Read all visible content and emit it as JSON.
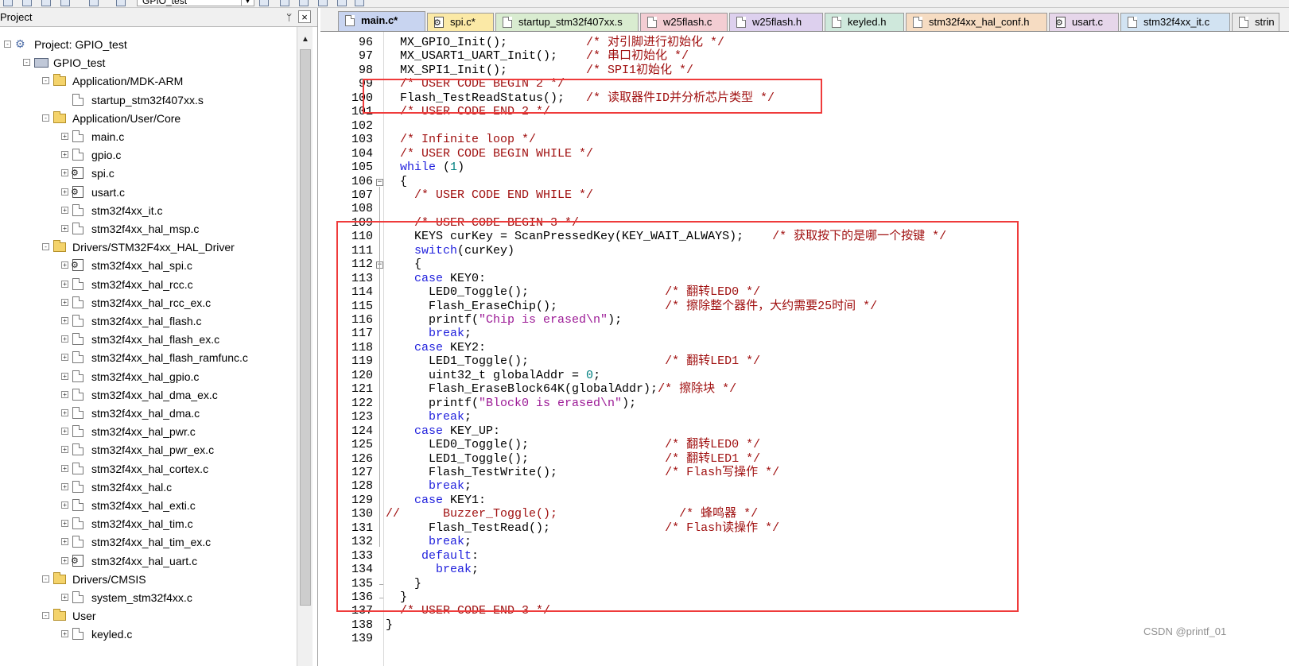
{
  "toolbar": {
    "target_name": "GPIO_test"
  },
  "project_panel": {
    "title": "Project",
    "pin_glyph": "ᛘ",
    "close_glyph": "×",
    "tree": [
      {
        "label": "Project: GPIO_test",
        "depth": 0,
        "kind": "project",
        "expander": "-"
      },
      {
        "label": "GPIO_test",
        "depth": 1,
        "kind": "target",
        "expander": "-"
      },
      {
        "label": "Application/MDK-ARM",
        "depth": 2,
        "kind": "folder",
        "expander": "-"
      },
      {
        "label": "startup_stm32f407xx.s",
        "depth": 3,
        "kind": "file",
        "expander": ""
      },
      {
        "label": "Application/User/Core",
        "depth": 2,
        "kind": "folder",
        "expander": "-"
      },
      {
        "label": "main.c",
        "depth": 3,
        "kind": "file",
        "expander": "+"
      },
      {
        "label": "gpio.c",
        "depth": 3,
        "kind": "file",
        "expander": "+"
      },
      {
        "label": "spi.c",
        "depth": 3,
        "kind": "gearfile",
        "expander": "+"
      },
      {
        "label": "usart.c",
        "depth": 3,
        "kind": "gearfile",
        "expander": "+"
      },
      {
        "label": "stm32f4xx_it.c",
        "depth": 3,
        "kind": "file",
        "expander": "+"
      },
      {
        "label": "stm32f4xx_hal_msp.c",
        "depth": 3,
        "kind": "file",
        "expander": "+"
      },
      {
        "label": "Drivers/STM32F4xx_HAL_Driver",
        "depth": 2,
        "kind": "folder",
        "expander": "-"
      },
      {
        "label": "stm32f4xx_hal_spi.c",
        "depth": 3,
        "kind": "gearfile",
        "expander": "+"
      },
      {
        "label": "stm32f4xx_hal_rcc.c",
        "depth": 3,
        "kind": "file",
        "expander": "+"
      },
      {
        "label": "stm32f4xx_hal_rcc_ex.c",
        "depth": 3,
        "kind": "file",
        "expander": "+"
      },
      {
        "label": "stm32f4xx_hal_flash.c",
        "depth": 3,
        "kind": "file",
        "expander": "+"
      },
      {
        "label": "stm32f4xx_hal_flash_ex.c",
        "depth": 3,
        "kind": "file",
        "expander": "+"
      },
      {
        "label": "stm32f4xx_hal_flash_ramfunc.c",
        "depth": 3,
        "kind": "file",
        "expander": "+"
      },
      {
        "label": "stm32f4xx_hal_gpio.c",
        "depth": 3,
        "kind": "file",
        "expander": "+"
      },
      {
        "label": "stm32f4xx_hal_dma_ex.c",
        "depth": 3,
        "kind": "file",
        "expander": "+"
      },
      {
        "label": "stm32f4xx_hal_dma.c",
        "depth": 3,
        "kind": "file",
        "expander": "+"
      },
      {
        "label": "stm32f4xx_hal_pwr.c",
        "depth": 3,
        "kind": "file",
        "expander": "+"
      },
      {
        "label": "stm32f4xx_hal_pwr_ex.c",
        "depth": 3,
        "kind": "file",
        "expander": "+"
      },
      {
        "label": "stm32f4xx_hal_cortex.c",
        "depth": 3,
        "kind": "file",
        "expander": "+"
      },
      {
        "label": "stm32f4xx_hal.c",
        "depth": 3,
        "kind": "file",
        "expander": "+"
      },
      {
        "label": "stm32f4xx_hal_exti.c",
        "depth": 3,
        "kind": "file",
        "expander": "+"
      },
      {
        "label": "stm32f4xx_hal_tim.c",
        "depth": 3,
        "kind": "file",
        "expander": "+"
      },
      {
        "label": "stm32f4xx_hal_tim_ex.c",
        "depth": 3,
        "kind": "file",
        "expander": "+"
      },
      {
        "label": "stm32f4xx_hal_uart.c",
        "depth": 3,
        "kind": "gearfile",
        "expander": "+"
      },
      {
        "label": "Drivers/CMSIS",
        "depth": 2,
        "kind": "folder",
        "expander": "-"
      },
      {
        "label": "system_stm32f4xx.c",
        "depth": 3,
        "kind": "file",
        "expander": "+"
      },
      {
        "label": "User",
        "depth": 2,
        "kind": "folder",
        "expander": "-"
      },
      {
        "label": "keyled.c",
        "depth": 3,
        "kind": "file",
        "expander": "+"
      }
    ]
  },
  "tabs": [
    {
      "label": "main.c*",
      "color": "#c8d4f0",
      "icon": "file",
      "active": true
    },
    {
      "label": "spi.c*",
      "color": "#fbe9a6",
      "icon": "gearfile",
      "active": false
    },
    {
      "label": "startup_stm32f407xx.s",
      "color": "#d9ecd0",
      "icon": "file",
      "active": false
    },
    {
      "label": "w25flash.c",
      "color": "#f3cdd3",
      "icon": "file",
      "active": false
    },
    {
      "label": "w25flash.h",
      "color": "#ddd0ee",
      "icon": "file",
      "active": false
    },
    {
      "label": "keyled.h",
      "color": "#cfe8dc",
      "icon": "file",
      "active": false
    },
    {
      "label": "stm32f4xx_hal_conf.h",
      "color": "#f6dcc2",
      "icon": "file",
      "active": false
    },
    {
      "label": "usart.c",
      "color": "#e6d6ea",
      "icon": "gearfile",
      "active": false
    },
    {
      "label": "stm32f4xx_it.c",
      "color": "#d2e3f2",
      "icon": "file",
      "active": false
    },
    {
      "label": "strin",
      "color": "#e9e9e9",
      "icon": "file",
      "active": false
    }
  ],
  "editor": {
    "lines": [
      {
        "n": "96",
        "fold": "",
        "code": [
          {
            "t": "  MX_GPIO_Init();           "
          },
          {
            "t": "/* 对引脚进行初始化 */",
            "c": "cm"
          }
        ]
      },
      {
        "n": "97",
        "fold": "",
        "code": [
          {
            "t": "  MX_USART1_UART_Init();    "
          },
          {
            "t": "/* 串口初始化 */",
            "c": "cm"
          }
        ]
      },
      {
        "n": "98",
        "fold": "",
        "code": [
          {
            "t": "  MX_SPI1_Init();           "
          },
          {
            "t": "/* SPI1初始化 */",
            "c": "cm"
          }
        ]
      },
      {
        "n": "99",
        "fold": "",
        "code": [
          {
            "t": "  "
          },
          {
            "t": "/* USER CODE BEGIN 2 */",
            "c": "cm"
          }
        ]
      },
      {
        "n": "100",
        "fold": "",
        "code": [
          {
            "t": "  Flash_TestReadStatus();   "
          },
          {
            "t": "/* 读取器件ID并分析芯片类型 */",
            "c": "cm"
          }
        ]
      },
      {
        "n": "101",
        "fold": "",
        "code": [
          {
            "t": "  "
          },
          {
            "t": "/* USER CODE END 2 */",
            "c": "cm"
          }
        ]
      },
      {
        "n": "102",
        "fold": "",
        "code": [
          {
            "t": ""
          }
        ]
      },
      {
        "n": "103",
        "fold": "",
        "code": [
          {
            "t": "  "
          },
          {
            "t": "/* Infinite loop */",
            "c": "cm"
          }
        ]
      },
      {
        "n": "104",
        "fold": "",
        "code": [
          {
            "t": "  "
          },
          {
            "t": "/* USER CODE BEGIN WHILE */",
            "c": "cm"
          }
        ]
      },
      {
        "n": "105",
        "fold": "",
        "code": [
          {
            "t": "  "
          },
          {
            "t": "while",
            "c": "kw"
          },
          {
            "t": " ("
          },
          {
            "t": "1",
            "c": "num"
          },
          {
            "t": ")"
          }
        ]
      },
      {
        "n": "106",
        "fold": "-",
        "code": [
          {
            "t": "  {"
          }
        ]
      },
      {
        "n": "107",
        "fold": "",
        "code": [
          {
            "t": "    "
          },
          {
            "t": "/* USER CODE END WHILE */",
            "c": "cm"
          }
        ]
      },
      {
        "n": "108",
        "fold": "",
        "code": [
          {
            "t": ""
          }
        ]
      },
      {
        "n": "109",
        "fold": "",
        "code": [
          {
            "t": "    "
          },
          {
            "t": "/* USER CODE BEGIN 3 */",
            "c": "cm"
          }
        ]
      },
      {
        "n": "110",
        "fold": "",
        "code": [
          {
            "t": "    KEYS curKey = ScanPressedKey(KEY_WAIT_ALWAYS);    "
          },
          {
            "t": "/* 获取按下的是哪一个按键 */",
            "c": "cm"
          }
        ]
      },
      {
        "n": "111",
        "fold": "",
        "code": [
          {
            "t": "    "
          },
          {
            "t": "switch",
            "c": "kw"
          },
          {
            "t": "(curKey)"
          }
        ]
      },
      {
        "n": "112",
        "fold": "-",
        "code": [
          {
            "t": "    {"
          }
        ]
      },
      {
        "n": "113",
        "fold": "",
        "code": [
          {
            "t": "    "
          },
          {
            "t": "case",
            "c": "kw"
          },
          {
            "t": " KEY0:"
          }
        ]
      },
      {
        "n": "114",
        "fold": "",
        "code": [
          {
            "t": "      LED0_Toggle();                   "
          },
          {
            "t": "/* 翻转LED0 */",
            "c": "cm"
          }
        ]
      },
      {
        "n": "115",
        "fold": "",
        "code": [
          {
            "t": "      Flash_EraseChip();               "
          },
          {
            "t": "/* 擦除整个器件，大约需要25时间 */",
            "c": "cm"
          }
        ]
      },
      {
        "n": "116",
        "fold": "",
        "code": [
          {
            "t": "      printf("
          },
          {
            "t": "\"Chip is erased\\n\"",
            "c": "str"
          },
          {
            "t": ");"
          }
        ]
      },
      {
        "n": "117",
        "fold": "",
        "code": [
          {
            "t": "      "
          },
          {
            "t": "break",
            "c": "kw"
          },
          {
            "t": ";"
          }
        ]
      },
      {
        "n": "118",
        "fold": "",
        "code": [
          {
            "t": "    "
          },
          {
            "t": "case",
            "c": "kw"
          },
          {
            "t": " KEY2:"
          }
        ]
      },
      {
        "n": "119",
        "fold": "",
        "code": [
          {
            "t": "      LED1_Toggle();                   "
          },
          {
            "t": "/* 翻转LED1 */",
            "c": "cm"
          }
        ]
      },
      {
        "n": "120",
        "fold": "",
        "code": [
          {
            "t": "      uint32_t globalAddr = "
          },
          {
            "t": "0",
            "c": "num"
          },
          {
            "t": ";"
          }
        ]
      },
      {
        "n": "121",
        "fold": "",
        "code": [
          {
            "t": "      Flash_EraseBlock64K(globalAddr);"
          },
          {
            "t": "/* 擦除块 */",
            "c": "cm"
          }
        ]
      },
      {
        "n": "122",
        "fold": "",
        "code": [
          {
            "t": "      printf("
          },
          {
            "t": "\"Block0 is erased\\n\"",
            "c": "str"
          },
          {
            "t": ");"
          }
        ]
      },
      {
        "n": "123",
        "fold": "",
        "code": [
          {
            "t": "      "
          },
          {
            "t": "break",
            "c": "kw"
          },
          {
            "t": ";"
          }
        ]
      },
      {
        "n": "124",
        "fold": "",
        "code": [
          {
            "t": "    "
          },
          {
            "t": "case",
            "c": "kw"
          },
          {
            "t": " KEY_UP:"
          }
        ]
      },
      {
        "n": "125",
        "fold": "",
        "code": [
          {
            "t": "      LED0_Toggle();                   "
          },
          {
            "t": "/* 翻转LED0 */",
            "c": "cm"
          }
        ]
      },
      {
        "n": "126",
        "fold": "",
        "code": [
          {
            "t": "      LED1_Toggle();                   "
          },
          {
            "t": "/* 翻转LED1 */",
            "c": "cm"
          }
        ]
      },
      {
        "n": "127",
        "fold": "",
        "code": [
          {
            "t": "      Flash_TestWrite();               "
          },
          {
            "t": "/* Flash写操作 */",
            "c": "cm"
          }
        ]
      },
      {
        "n": "128",
        "fold": "",
        "code": [
          {
            "t": "      "
          },
          {
            "t": "break",
            "c": "kw"
          },
          {
            "t": ";"
          }
        ]
      },
      {
        "n": "129",
        "fold": "",
        "code": [
          {
            "t": "    "
          },
          {
            "t": "case",
            "c": "kw"
          },
          {
            "t": " KEY1:"
          }
        ]
      },
      {
        "n": "130",
        "fold": "",
        "code": [
          {
            "t": "//",
            "c": "cm"
          },
          {
            "t": "      Buzzer_Toggle();                 ",
            "c": "cm"
          },
          {
            "t": "/* 蜂鸣器 */",
            "c": "cm"
          }
        ]
      },
      {
        "n": "131",
        "fold": "",
        "code": [
          {
            "t": "      Flash_TestRead();                "
          },
          {
            "t": "/* Flash读操作 */",
            "c": "cm"
          }
        ]
      },
      {
        "n": "132",
        "fold": "",
        "code": [
          {
            "t": "      "
          },
          {
            "t": "break",
            "c": "kw"
          },
          {
            "t": ";"
          }
        ]
      },
      {
        "n": "133",
        "fold": "",
        "code": [
          {
            "t": "     "
          },
          {
            "t": "default",
            "c": "kw"
          },
          {
            "t": ":"
          }
        ]
      },
      {
        "n": "134",
        "fold": "",
        "code": [
          {
            "t": "       "
          },
          {
            "t": "break",
            "c": "kw"
          },
          {
            "t": ";"
          }
        ]
      },
      {
        "n": "135",
        "fold": "",
        "code": [
          {
            "t": "    }"
          }
        ]
      },
      {
        "n": "136",
        "fold": "",
        "code": [
          {
            "t": "  }"
          }
        ]
      },
      {
        "n": "137",
        "fold": "",
        "code": [
          {
            "t": "  "
          },
          {
            "t": "/* USER CODE END 3 */",
            "c": "cm"
          }
        ]
      },
      {
        "n": "138",
        "fold": "",
        "code": [
          {
            "t": "}"
          }
        ]
      },
      {
        "n": "139",
        "fold": "",
        "code": [
          {
            "t": ""
          }
        ]
      }
    ]
  },
  "watermark": "CSDN @printf_01"
}
